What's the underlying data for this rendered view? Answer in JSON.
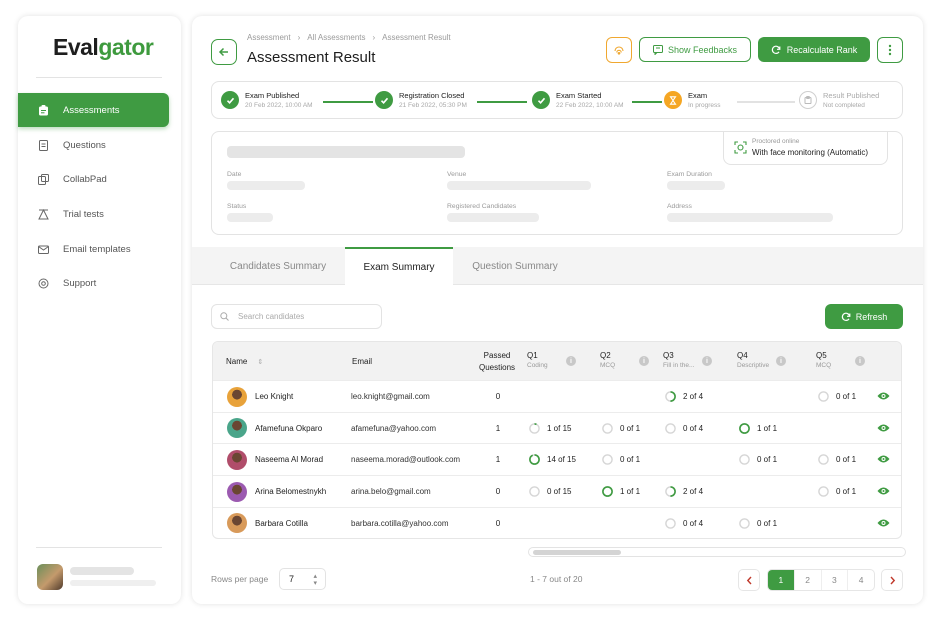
{
  "brand": {
    "part1": "Eval",
    "part2": "gator"
  },
  "sidebar": {
    "items": [
      {
        "label": "Assessments",
        "icon": "assessments-icon",
        "active": true
      },
      {
        "label": "Questions",
        "icon": "questions-icon",
        "active": false
      },
      {
        "label": "CollabPad",
        "icon": "collabpad-icon",
        "active": false
      },
      {
        "label": "Trial tests",
        "icon": "trial-tests-icon",
        "active": false
      },
      {
        "label": "Email templates",
        "icon": "email-icon",
        "active": false
      },
      {
        "label": "Support",
        "icon": "support-icon",
        "active": false
      }
    ]
  },
  "header": {
    "breadcrumb": [
      "Assessment",
      "All Assessments",
      "Assessment Result"
    ],
    "title": "Assessment Result",
    "show_feedbacks": "Show Feedbacks",
    "recalculate": "Recalculate Rank"
  },
  "steps": [
    {
      "title": "Exam Published",
      "date": "20 Feb 2022, 10:00 AM",
      "state": "done"
    },
    {
      "title": "Registration Closed",
      "date": "21 Feb 2022, 05:30 PM",
      "state": "done"
    },
    {
      "title": "Exam Started",
      "date": "22 Feb 2022, 10:00 AM",
      "state": "done"
    },
    {
      "title": "Exam",
      "date": "In progress",
      "state": "current"
    },
    {
      "title": "Result Published",
      "date": "Not completed",
      "state": "pending"
    }
  ],
  "info": {
    "labels": {
      "date": "Date",
      "venue": "Venue",
      "duration": "Exam Duration",
      "status": "Status",
      "registered": "Registered Candidates",
      "address": "Address"
    },
    "proctor_title": "Proctored online",
    "proctor_value": "With face monitoring (Automatic)"
  },
  "tabs": [
    {
      "label": "Candidates Summary",
      "active": false
    },
    {
      "label": "Exam Summary",
      "active": true
    },
    {
      "label": "Question Summary",
      "active": false
    }
  ],
  "search": {
    "placeholder": "Search candidates"
  },
  "refresh": "Refresh",
  "table": {
    "headers": {
      "name": "Name",
      "email": "Email",
      "passed1": "Passed",
      "passed2": "Questions"
    },
    "questions": [
      {
        "label": "Q1",
        "type": "Coding"
      },
      {
        "label": "Q2",
        "type": "MCQ"
      },
      {
        "label": "Q3",
        "type": "Fill in the..."
      },
      {
        "label": "Q4",
        "type": "Descriptive"
      },
      {
        "label": "Q5",
        "type": "MCQ"
      }
    ],
    "rows": [
      {
        "name": "Leo Knight",
        "email": "leo.knight@gmail.com",
        "passed": "0",
        "avatar": "#e8a23a",
        "q": [
          null,
          null,
          {
            "t": "2 of 4",
            "p": 0.5
          },
          null,
          {
            "t": "0 of 1",
            "p": 0
          }
        ]
      },
      {
        "name": "Afamefuna Okparo",
        "email": "afamefuna@yahoo.com",
        "passed": "1",
        "avatar": "#4aa58a",
        "q": [
          {
            "t": "1 of 15",
            "p": 0.07
          },
          {
            "t": "0 of 1",
            "p": 0
          },
          {
            "t": "0 of 4",
            "p": 0
          },
          {
            "t": "1 of 1",
            "p": 1
          },
          null
        ]
      },
      {
        "name": "Naseema Al Morad",
        "email": "naseema.morad@outlook.com",
        "passed": "1",
        "avatar": "#b04d6a",
        "q": [
          {
            "t": "14 of 15",
            "p": 0.93
          },
          {
            "t": "0 of 1",
            "p": 0
          },
          null,
          {
            "t": "0 of 1",
            "p": 0
          },
          {
            "t": "0 of 1",
            "p": 0
          }
        ]
      },
      {
        "name": "Arina Belomestnykh",
        "email": "arina.belo@gmail.com",
        "passed": "0",
        "avatar": "#9b5ab0",
        "q": [
          {
            "t": "0 of 15",
            "p": 0
          },
          {
            "t": "1 of 1",
            "p": 1
          },
          {
            "t": "2 of 4",
            "p": 0.5
          },
          null,
          {
            "t": "0 of 1",
            "p": 0
          }
        ]
      },
      {
        "name": "Barbara Cotilla",
        "email": "barbara.cotilla@yahoo.com",
        "passed": "0",
        "avatar": "#d89a5a",
        "q": [
          null,
          null,
          {
            "t": "0 of 4",
            "p": 0
          },
          {
            "t": "0 of 1",
            "p": 0
          },
          null
        ]
      }
    ]
  },
  "footer": {
    "rows_label": "Rows per page",
    "rows_value": "7",
    "range": "1 - 7 out of 20",
    "pages": [
      "1",
      "2",
      "3",
      "4"
    ],
    "current_page": "1"
  },
  "colors": {
    "accent": "#3f9b42",
    "warning": "#f5a623"
  }
}
